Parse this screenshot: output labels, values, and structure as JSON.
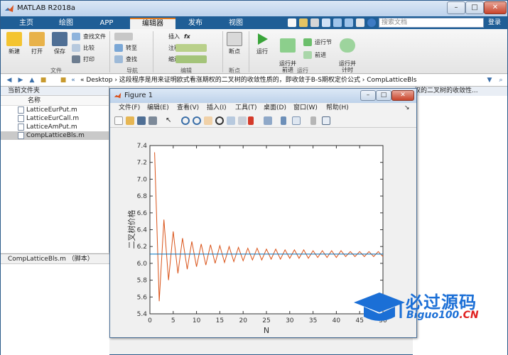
{
  "window": {
    "title": "MATLAB R2018a"
  },
  "tabs": [
    {
      "label": "主页"
    },
    {
      "label": "绘图"
    },
    {
      "label": "APP"
    },
    {
      "label": "编辑器"
    },
    {
      "label": "发布"
    },
    {
      "label": "视图"
    }
  ],
  "search": {
    "placeholder": "搜索文档",
    "login_label": "登录"
  },
  "ribbon": {
    "file": {
      "group_label": "文件",
      "new": "新建",
      "open": "打开",
      "save": "保存",
      "find_files": "查找文件",
      "compare": "比较",
      "print": "打印"
    },
    "navigate": {
      "group_label": "导航",
      "goto": "转至",
      "find": "查找"
    },
    "edit": {
      "group_label": "编辑",
      "insert": "插入",
      "comment": "注释",
      "indent": "缩进",
      "fx": "fx"
    },
    "breakpoints": {
      "group_label": "断点",
      "breakpoints": "断点"
    },
    "run": {
      "group_label": "运行",
      "run": "运行",
      "run_advance": "运行并\n前进",
      "run_section": "运行节",
      "advance": "前进",
      "run_time": "运行并\n计时"
    }
  },
  "address": {
    "path": "« Desktop › 这段程序是用来证明欧式看涨期权的二叉树的收敛性质的，即收敛于B-S期权定价公式 › CompLatticeBls"
  },
  "current_folder": {
    "title": "当前文件夹",
    "column_name": "名称",
    "files": [
      {
        "name": "LatticeEurPut.m",
        "selected": false
      },
      {
        "name": "LatticeEurCall.m",
        "selected": false
      },
      {
        "name": "LatticeAmPut.m",
        "selected": false
      },
      {
        "name": "CompLatticeBls.m",
        "selected": true
      }
    ]
  },
  "details": {
    "title": "CompLatticeBls.m （脚本）"
  },
  "right_panel": {
    "title": "权的二叉树的收敛性..."
  },
  "figure": {
    "title": "Figure 1",
    "menus": [
      {
        "label": "文件(F)"
      },
      {
        "label": "编辑(E)"
      },
      {
        "label": "查看(V)"
      },
      {
        "label": "插入(I)"
      },
      {
        "label": "工具(T)"
      },
      {
        "label": "桌面(D)"
      },
      {
        "label": "窗口(W)"
      },
      {
        "label": "帮助(H)"
      }
    ]
  },
  "chart_data": {
    "type": "line",
    "title": "",
    "xlabel": "N",
    "ylabel": "二叉树价格",
    "xlim": [
      0,
      50
    ],
    "ylim": [
      5.4,
      7.4
    ],
    "xticks": [
      0,
      5,
      10,
      15,
      20,
      25,
      30,
      35,
      40,
      45,
      50
    ],
    "yticks": [
      5.4,
      5.6,
      5.8,
      6.0,
      6.2,
      6.4,
      6.6,
      6.8,
      7.0,
      7.2,
      7.4
    ],
    "grid": false,
    "series": [
      {
        "color": "#d95319",
        "x": [
          1,
          2,
          3,
          4,
          5,
          6,
          7,
          8,
          9,
          10,
          11,
          12,
          13,
          14,
          15,
          16,
          17,
          18,
          19,
          20,
          21,
          22,
          23,
          24,
          25,
          26,
          27,
          28,
          29,
          30,
          31,
          32,
          33,
          34,
          35,
          36,
          37,
          38,
          39,
          40,
          41,
          42,
          43,
          44,
          45,
          46,
          47,
          48,
          49,
          50
        ],
        "y": [
          7.32,
          5.55,
          6.52,
          5.8,
          6.38,
          5.88,
          6.3,
          5.93,
          6.26,
          5.96,
          6.23,
          5.98,
          6.22,
          6.0,
          6.21,
          6.01,
          6.2,
          6.02,
          6.19,
          6.03,
          6.18,
          6.04,
          6.18,
          6.04,
          6.17,
          6.05,
          6.17,
          6.05,
          6.16,
          6.06,
          6.16,
          6.06,
          6.16,
          6.06,
          6.15,
          6.07,
          6.15,
          6.07,
          6.15,
          6.07,
          6.15,
          6.08,
          6.14,
          6.08,
          6.14,
          6.08,
          6.14,
          6.08,
          6.14,
          6.08
        ]
      },
      {
        "color": "#0072bd",
        "x": [
          0,
          50
        ],
        "y": [
          6.11,
          6.11
        ]
      }
    ]
  },
  "watermark": {
    "big": "必过源码",
    "small_prefix": "Biguo100",
    "small_suffix": ".CN"
  }
}
